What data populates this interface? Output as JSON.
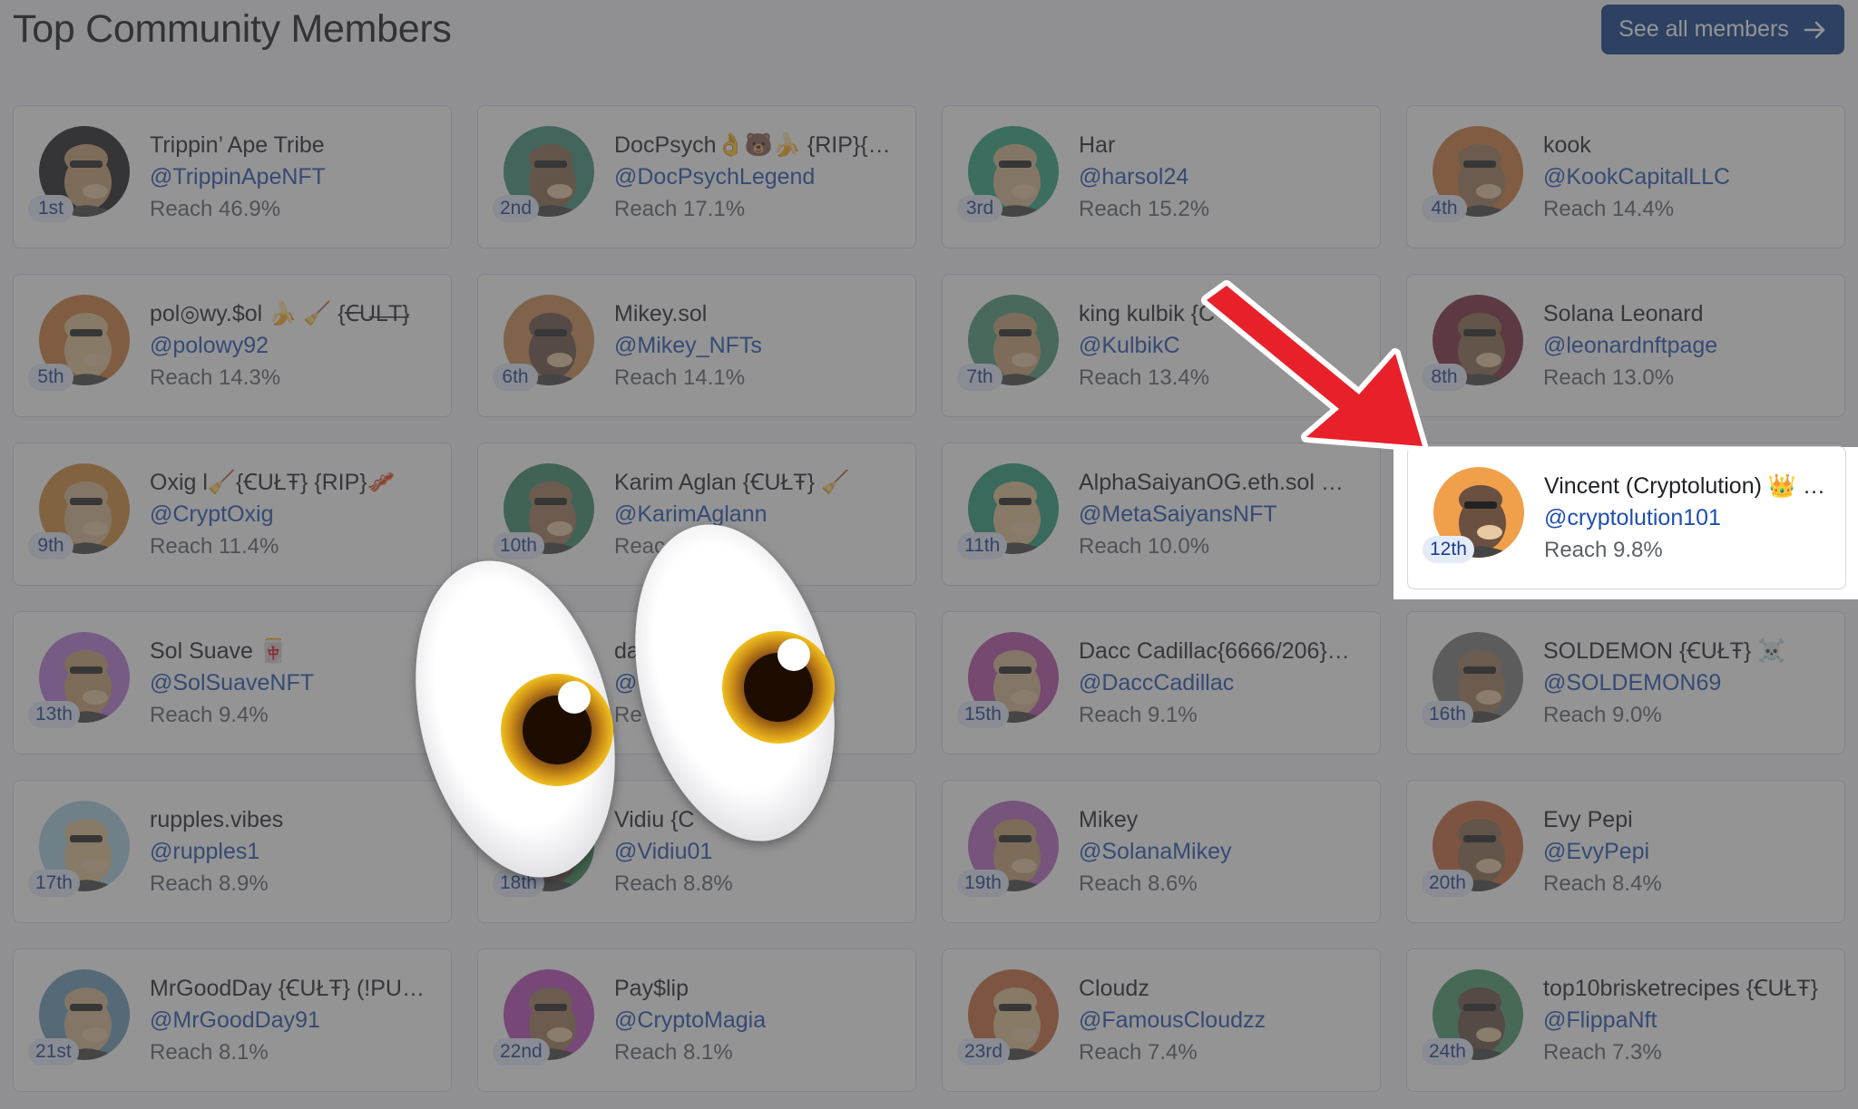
{
  "header": {
    "title": "Top Community Members",
    "see_all_label": "See all members"
  },
  "members": [
    {
      "rank": "1st",
      "name": "Trippin’ Ape Tribe",
      "handle": "@TrippinApeNFT",
      "reach": "Reach 46.9%"
    },
    {
      "rank": "2nd",
      "name": "DocPsych👌🐻🍌 {RIP}{C…",
      "handle": "@DocPsychLegend",
      "reach": "Reach 17.1%"
    },
    {
      "rank": "3rd",
      "name": "Har",
      "handle": "@harsol24",
      "reach": "Reach 15.2%"
    },
    {
      "rank": "4th",
      "name": "kook",
      "handle": "@KookCapitalLLC",
      "reach": "Reach 14.4%"
    },
    {
      "rank": "5th",
      "name": "pol◎wy.$ol 🍌 🧹 {Ꞓ̶U̶L̶T̶}",
      "handle": "@polowy92",
      "reach": "Reach 14.3%"
    },
    {
      "rank": "6th",
      "name": "Mikey.sol",
      "handle": "@Mikey_NFTs",
      "reach": "Reach 14.1%"
    },
    {
      "rank": "7th",
      "name": "king kulbik {C",
      "handle": "@KulbikC",
      "reach": "Reach 13.4%"
    },
    {
      "rank": "8th",
      "name": "Solana Leonard",
      "handle": "@leonardnftpage",
      "reach": "Reach 13.0%"
    },
    {
      "rank": "9th",
      "name": "Oxig l🧹{ꞒUŁŦ} {RIP}🥓",
      "handle": "@CryptOxig",
      "reach": "Reach 11.4%"
    },
    {
      "rank": "10th",
      "name": "Karim Aglan {ꞒUŁŦ} 🧹",
      "handle": "@KarimAglann",
      "reach": "Reac"
    },
    {
      "rank": "11th",
      "name": "AlphaSaiyanOG.eth.sol …",
      "handle": "@MetaSaiyansNFT",
      "reach": "Reach 10.0%"
    },
    {
      "rank": "12th",
      "name": "Vincent (Cryptolution) 👑 …",
      "handle": "@cryptolution101",
      "reach": "Reach 9.8%"
    },
    {
      "rank": "13th",
      "name": "Sol Suave 🀄",
      "handle": "@SolSuaveNFT",
      "reach": "Reach 9.4%"
    },
    {
      "rank": "",
      "name": "da",
      "handle": "@",
      "reach": "Re"
    },
    {
      "rank": "15th",
      "name": "Dacc Cadillac{6666/206}…",
      "handle": "@DaccCadillac",
      "reach": "Reach 9.1%"
    },
    {
      "rank": "16th",
      "name": "SOLDEMON {ꞒUŁŦ} ☠️",
      "handle": "@SOLDEMON69",
      "reach": "Reach 9.0%"
    },
    {
      "rank": "17th",
      "name": "rupples.vibes",
      "handle": "@rupples1",
      "reach": "Reach 8.9%"
    },
    {
      "rank": "18th",
      "name": "Vidiu {C",
      "handle": "@Vidiu01",
      "reach": "Reach 8.8%"
    },
    {
      "rank": "19th",
      "name": "Mikey",
      "handle": "@SolanaMikey",
      "reach": "Reach 8.6%"
    },
    {
      "rank": "20th",
      "name": "Evy Pepi",
      "handle": "@EvyPepi",
      "reach": "Reach 8.4%"
    },
    {
      "rank": "21st",
      "name": "MrGoodDay {ꞒUŁŦ} (!PU…",
      "handle": "@MrGoodDay91",
      "reach": "Reach 8.1%"
    },
    {
      "rank": "22nd",
      "name": "Pay$lip",
      "handle": "@CryptoMagia",
      "reach": "Reach 8.1%"
    },
    {
      "rank": "23rd",
      "name": "Cloudz",
      "handle": "@FamousCloudzz",
      "reach": "Reach 7.4%"
    },
    {
      "rank": "24th",
      "name": "top10brisketrecipes {ꞒUŁŦ}",
      "handle": "@FlippaNft",
      "reach": "Reach 7.3%"
    }
  ],
  "avatar_colors": [
    "#1d1d1f",
    "#3d8f7a",
    "#2fa581",
    "#d07a3c",
    "#cf7a3a",
    "#cc8a4e",
    "#4a9a78",
    "#7c2a3a",
    "#d48a38",
    "#3a8a6a",
    "#2a9a7a",
    "#f0a04a",
    "#b878d8",
    "#9e9e9e",
    "#b84ea8",
    "#7a7a7a",
    "#a8d0e0",
    "#3a8a5a",
    "#b868c0",
    "#c8683a",
    "#6a9ab8",
    "#b848b8",
    "#c86a3a",
    "#4a9a6a"
  ],
  "annotations": {
    "arrow_color": "#e8202a",
    "highlight_color": "#ffffff",
    "emoji": "eyes"
  },
  "colors": {
    "accent": "#0b3a86",
    "link": "#1f4fae",
    "rank_badge_bg": "#e4ecfa"
  }
}
